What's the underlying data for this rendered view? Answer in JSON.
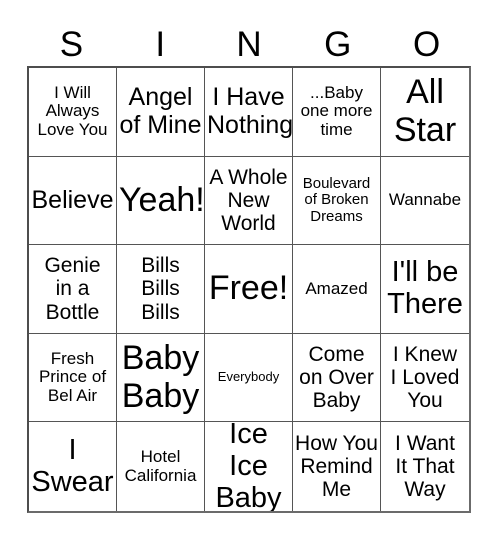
{
  "card": {
    "title_letters": [
      "S",
      "I",
      "N",
      "G",
      "O"
    ],
    "background_color": "#ffffff",
    "text_color": "#000000",
    "grid_line_color": "#555555",
    "rows": 5,
    "columns": 5,
    "cells": [
      {
        "text": "I Will\nAlways\nLove You",
        "size": "sm"
      },
      {
        "text": "Angel\nof Mine",
        "size": "lg"
      },
      {
        "text": "I Have\nNothing",
        "size": "lg"
      },
      {
        "text": "...Baby\none more\ntime",
        "size": "sm"
      },
      {
        "text": "All\nStar",
        "size": "xxl"
      },
      {
        "text": "Believe",
        "size": "lg"
      },
      {
        "text": "Yeah!",
        "size": "xxl"
      },
      {
        "text": "A Whole\nNew\nWorld",
        "size": "md"
      },
      {
        "text": "Boulevard\nof Broken\nDreams",
        "size": "xs"
      },
      {
        "text": "Wannabe",
        "size": "sm"
      },
      {
        "text": "Genie\nin a\nBottle",
        "size": "md"
      },
      {
        "text": "Bills\nBills\nBills",
        "size": "md"
      },
      {
        "text": "Free!",
        "size": "xxl"
      },
      {
        "text": "Amazed",
        "size": "sm"
      },
      {
        "text": "I'll be\nThere",
        "size": "xl"
      },
      {
        "text": "Fresh\nPrince of\nBel Air",
        "size": "sm"
      },
      {
        "text": "Baby\nBaby",
        "size": "xxl"
      },
      {
        "text": "Everybody",
        "size": "xxs"
      },
      {
        "text": "Come\non Over\nBaby",
        "size": "md"
      },
      {
        "text": "I Knew\nI Loved\nYou",
        "size": "md"
      },
      {
        "text": "I\nSwear",
        "size": "xl"
      },
      {
        "text": "Hotel\nCalifornia",
        "size": "sm"
      },
      {
        "text": "Ice Ice\nBaby",
        "size": "xl"
      },
      {
        "text": "How You\nRemind\nMe",
        "size": "md"
      },
      {
        "text": "I Want\nIt That\nWay",
        "size": "md"
      }
    ]
  }
}
